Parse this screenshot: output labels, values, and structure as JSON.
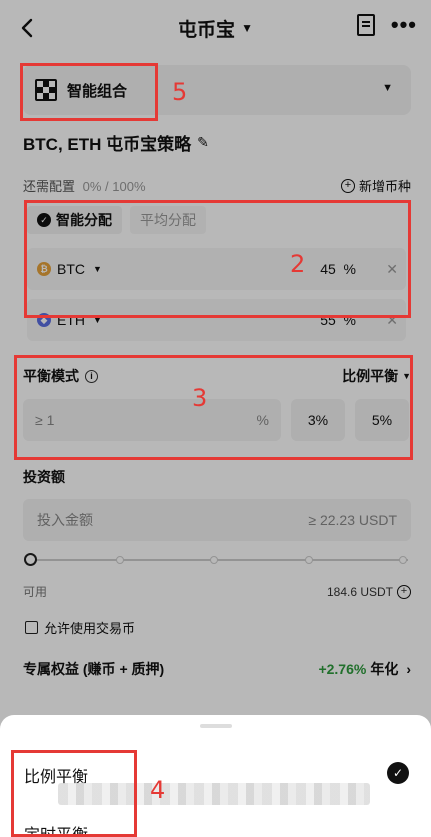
{
  "header": {
    "title": "屯币宝"
  },
  "portfolio": {
    "label": "智能组合"
  },
  "strategy": {
    "title": "BTC, ETH 屯币宝策略"
  },
  "allocation": {
    "label": "还需配置",
    "value": "0% / 100%",
    "add_label": "新增币种"
  },
  "modes": {
    "smart": "智能分配",
    "even": "平均分配"
  },
  "coins": [
    {
      "symbol": "BTC",
      "percent": "45",
      "unit": "%",
      "color": "#e6a23c"
    },
    {
      "symbol": "ETH",
      "percent": "55",
      "unit": "%",
      "color": "#5b6ee1"
    }
  ],
  "balance": {
    "label": "平衡模式",
    "mode": "比例平衡",
    "input_prefix": "≥ 1",
    "input_unit": "%",
    "presets": [
      "3%",
      "5%"
    ]
  },
  "invest": {
    "label": "投资额",
    "placeholder": "投入金额",
    "min": "≥ 22.23 USDT",
    "slider_fraction": 0
  },
  "available": {
    "label": "可用",
    "amount": "184.6 USDT"
  },
  "allow": {
    "label": "允许使用交易币"
  },
  "perk": {
    "label": "专属权益 (赚币 + 质押)",
    "apy": "+2.76%",
    "suffix": "年化"
  },
  "sheet": {
    "options": [
      "比例平衡",
      "定时平衡"
    ]
  },
  "annotations": [
    "5",
    "2",
    "3",
    "4"
  ],
  "colors": {
    "annotation": "#e53935",
    "apy": "#2e9b3e"
  }
}
